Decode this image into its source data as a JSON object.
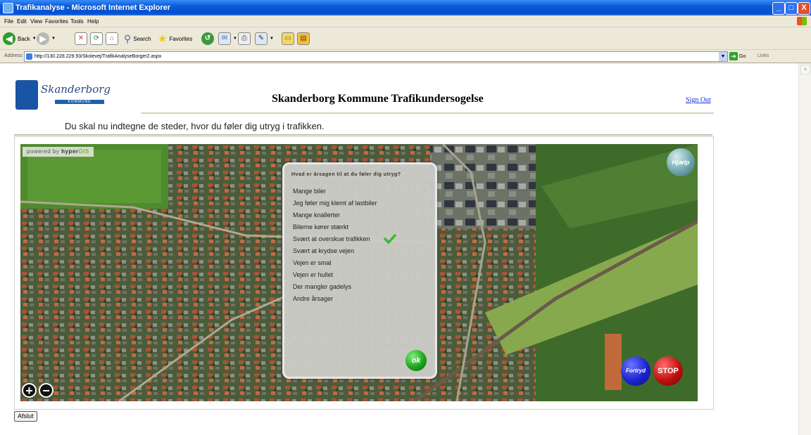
{
  "window": {
    "title": "Trafikanalyse - Microsoft Internet Explorer",
    "minimize": "_",
    "maximize": "□",
    "close": "X"
  },
  "menu": [
    "File",
    "Edit",
    "View",
    "Favorites",
    "Tools",
    "Help"
  ],
  "toolbar": {
    "back": "Back",
    "search": "Search",
    "favorites": "Favorites"
  },
  "address": {
    "label": "Address",
    "url": "http://130.228.229.93/Skolevej/TrafikAnalyseBorger2.aspx",
    "go": "Go",
    "links": "Links"
  },
  "page": {
    "logo_text": "Skanderborg",
    "logo_sub": "KOMMUNE",
    "title": "Skanderborg Kommune Trafikundersogelse",
    "sign_out": "Sign Out",
    "instruction": "Du skal nu indtegne de steder, hvor du føler dig utryg i trafikken."
  },
  "map": {
    "powered_prefix": "powered by",
    "powered_brand_a": "hyper",
    "powered_brand_b": "GIS",
    "help": "Hjælp",
    "zoom_in": "+",
    "zoom_out": "−",
    "undo": "Fortryd",
    "stop": "STOP"
  },
  "dialog": {
    "question": "Hvad er årsagen til at du føler dig utryg?",
    "options": [
      "Mange biler",
      "Jeg føler mig klemt af lastbiler",
      "Mange knallerter",
      "Bilerne kører stærkt",
      "Svært at overskue trafikken",
      "Svært at krydse vejen",
      "Vejen er smal",
      "Vejen er hullet",
      "Der mangler gadelys",
      "Andre årsager"
    ],
    "selected_index": 4,
    "ok": "ok"
  },
  "footer": {
    "finish": "Afslut"
  }
}
